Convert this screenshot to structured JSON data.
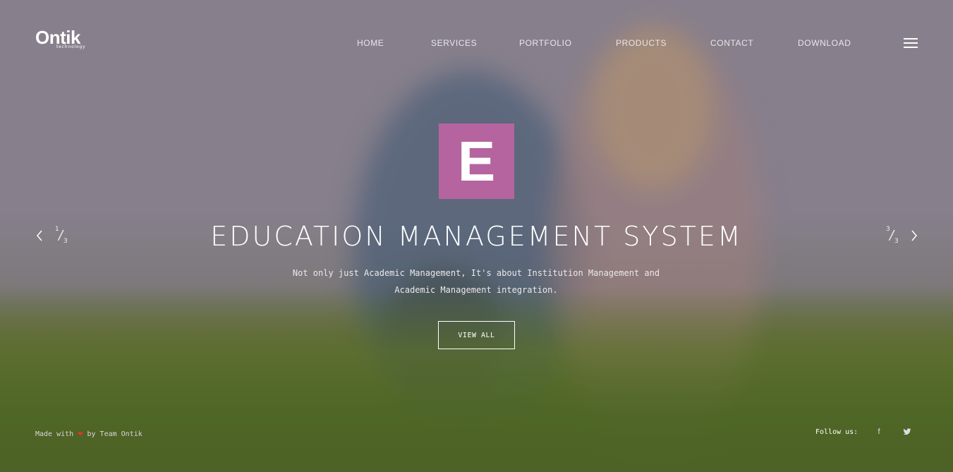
{
  "brand": {
    "logo_main": "Ontik",
    "logo_sub": "technology"
  },
  "nav": {
    "items": [
      {
        "label": "HOME"
      },
      {
        "label": "SERVICES"
      },
      {
        "label": "PORTFOLIO"
      },
      {
        "label": "PRODUCTS"
      },
      {
        "label": "CONTACT"
      },
      {
        "label": "DOWNLOAD"
      }
    ],
    "menu_icon": "hamburger-icon"
  },
  "hero": {
    "emblem_letter": "E",
    "emblem_color": "#b5649f",
    "title": "EDUCATION MANAGEMENT SYSTEM",
    "subtitle_line1": "Not only just Academic Management, It's about Institution Management and",
    "subtitle_line2": "Academic Management integration.",
    "cta_label": "VIEW ALL"
  },
  "slider": {
    "prev_index": "1",
    "prev_total": "3",
    "next_index": "3",
    "next_total": "3",
    "prev_icon": "chevron-left-icon",
    "next_icon": "chevron-right-icon"
  },
  "footer": {
    "made_with": "Made with",
    "heart": "❤",
    "by_team": "by Team Ontik",
    "follow_label": "Follow us:",
    "social": [
      {
        "icon": "facebook-icon",
        "glyph": "f"
      },
      {
        "icon": "twitter-icon",
        "glyph": "t"
      }
    ],
    "heart_color": "#e0342d"
  }
}
